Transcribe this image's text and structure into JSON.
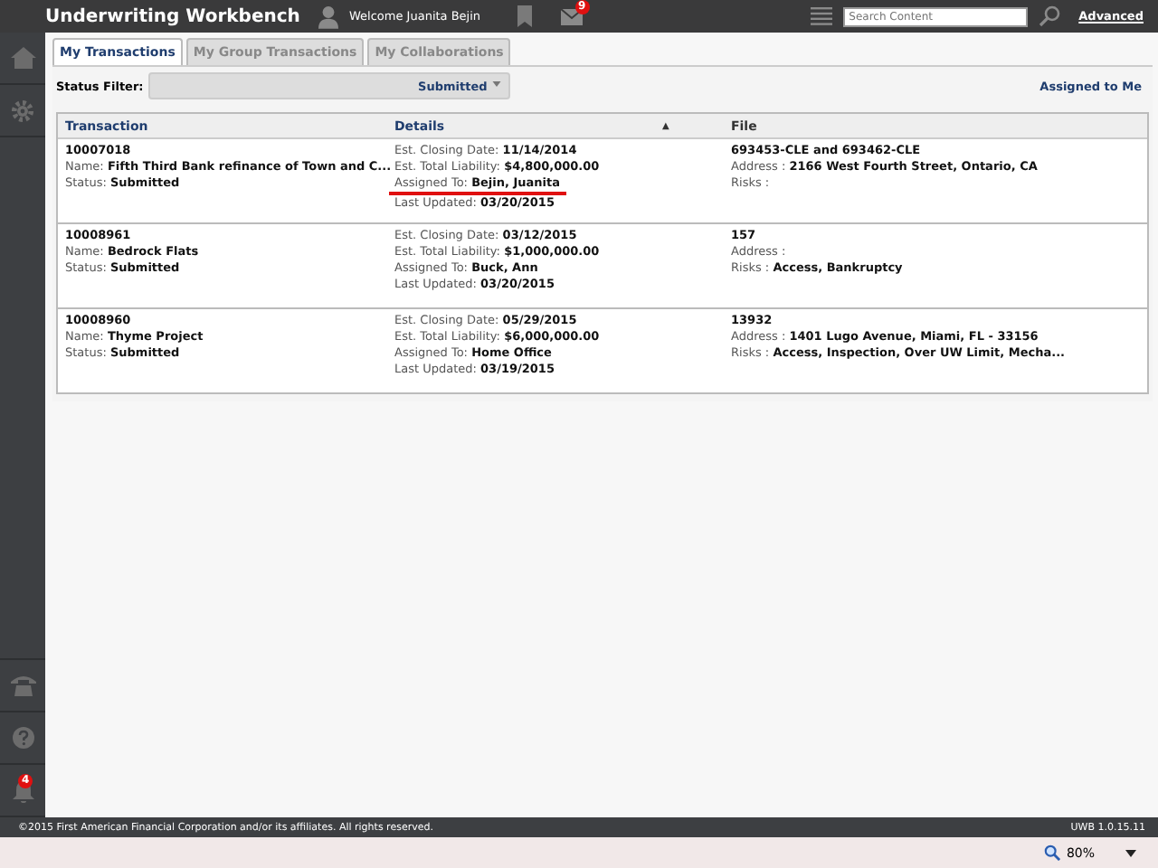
{
  "app": {
    "title": "Underwriting Workbench",
    "welcome": "Welcome Juanita Bejin",
    "messages_badge": "9",
    "search": {
      "placeholder": "Search Content"
    },
    "advanced_link": "Advanced"
  },
  "sidebar": {
    "notifications_badge": "4"
  },
  "tabs": [
    {
      "label": "My Transactions",
      "selected": true
    },
    {
      "label": "My Group Transactions",
      "selected": false
    },
    {
      "label": "My Collaborations",
      "selected": false
    }
  ],
  "filter": {
    "label": "Status Filter:",
    "value": "Submitted",
    "assigned_link": "Assigned to Me"
  },
  "table": {
    "columns": [
      "Transaction",
      "Details",
      "▲",
      "File"
    ],
    "rows": [
      {
        "id": "10007018",
        "name_label": "Name:",
        "name": "Fifth Third Bank refinance of Town and C...",
        "status_label": "Status:",
        "status": "Submitted",
        "details": [
          {
            "label": "Est. Closing Date:",
            "value": "11/14/2014",
            "underlined": false
          },
          {
            "label": "Est. Total Liability:",
            "value": "$4,800,000.00",
            "underlined": false
          },
          {
            "label": "Assigned To:",
            "value": "Bejin, Juanita",
            "underlined": true
          },
          {
            "label": "Last Updated:",
            "value": "03/20/2015",
            "underlined": false
          }
        ],
        "file": "693453-CLE and 693462-CLE",
        "file_lines": [
          {
            "label": "Address :",
            "value": "2166 West Fourth Street, Ontario, CA"
          },
          {
            "label": "Risks :"
          }
        ]
      },
      {
        "id": "10008961",
        "name_label": "Name:",
        "name": "Bedrock Flats",
        "status_label": "Status:",
        "status": "Submitted",
        "details": [
          {
            "label": "Est. Closing Date:",
            "value": "03/12/2015",
            "underlined": false
          },
          {
            "label": "Est. Total Liability:",
            "value": "$1,000,000.00",
            "underlined": false
          },
          {
            "label": "Assigned To:",
            "value": "Buck, Ann",
            "underlined": false
          },
          {
            "label": "Last Updated:",
            "value": "03/20/2015",
            "underlined": false
          }
        ],
        "file": "157",
        "file_lines": [
          {
            "label": "Address :"
          },
          {
            "label": "Risks :",
            "value": "Access, Bankruptcy"
          }
        ]
      },
      {
        "id": "10008960",
        "name_label": "Name:",
        "name": "Thyme Project",
        "status_label": "Status:",
        "status": "Submitted",
        "details": [
          {
            "label": "Est. Closing Date:",
            "value": "05/29/2015",
            "underlined": false
          },
          {
            "label": "Est. Total Liability:",
            "value": "$6,000,000.00",
            "underlined": false
          },
          {
            "label": "Assigned To:",
            "value": "Home Office",
            "underlined": false
          },
          {
            "label": "Last Updated:",
            "value": "03/19/2015",
            "underlined": false
          }
        ],
        "file": "13932",
        "file_lines": [
          {
            "label": "Address :",
            "value": "1401 Lugo Avenue, Miami, FL - 33156"
          },
          {
            "label": "Risks :",
            "value": "Access, Inspection, Over UW Limit, Mecha..."
          }
        ]
      }
    ]
  },
  "footer": {
    "copyright": "©2015 First American Financial Corporation and/or its affiliates. All rights reserved.",
    "version": "UWB 1.0.15.11"
  },
  "browser_bar": {
    "zoom": "80%"
  }
}
